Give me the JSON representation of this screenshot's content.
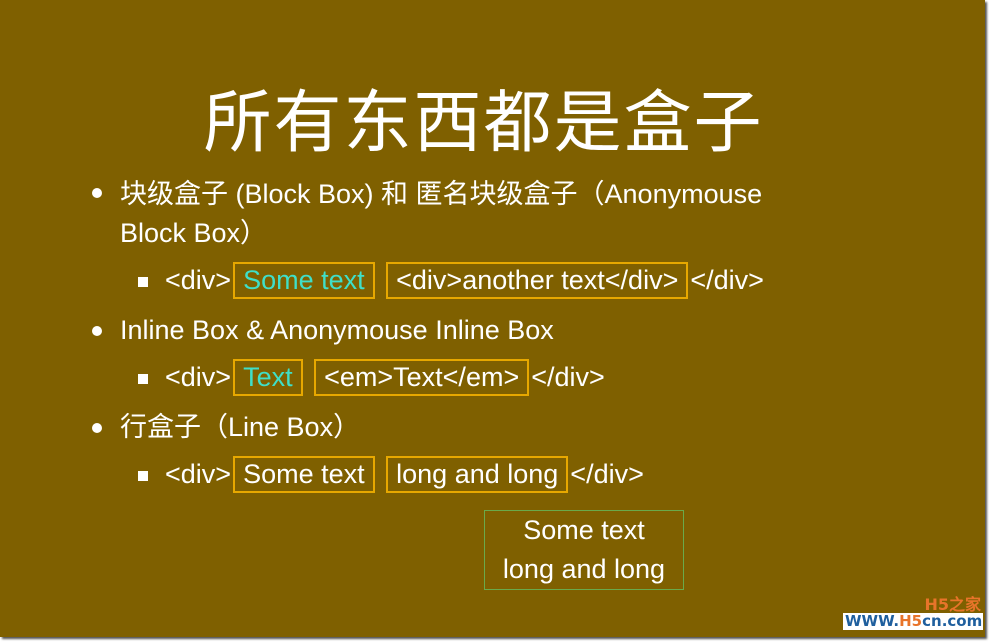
{
  "slide": {
    "title": "所有东西都是盒子",
    "background_color": "#7f6000",
    "accent_border_color": "#e7a800",
    "highlight_text_color": "#3fdfc8",
    "items": [
      {
        "text_line1": "块级盒子 (Block Box) 和 匿名块级盒子（Anonymouse",
        "text_line2": "Block Box）",
        "example": {
          "open": "<div>",
          "box1": "Some text",
          "box2": "<div>another text</div>",
          "close": "</div>"
        }
      },
      {
        "text_line1": "Inline Box & Anonymouse Inline Box",
        "example": {
          "open": "<div>",
          "box1": "Text",
          "box2": "<em>Text</em>",
          "close": "</div>"
        }
      },
      {
        "text_line1": "行盒子（Line Box）",
        "example": {
          "open": "<div>",
          "box1": "Some text",
          "box2": "long and long",
          "close": "</div>"
        }
      }
    ],
    "line_box_demo": {
      "line1": "Some text",
      "line2": "long and long"
    }
  },
  "watermark": {
    "top": "H5之家",
    "bottom_prefix": "WWW.",
    "bottom_brand": "H5",
    "bottom_suffix": "cn.com"
  }
}
